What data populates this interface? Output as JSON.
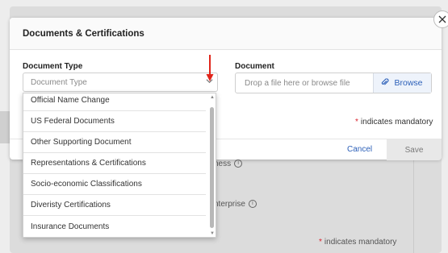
{
  "modal": {
    "title": "Documents & Certifications",
    "close_label": "×"
  },
  "document_type": {
    "label": "Document Type",
    "placeholder": "Document Type"
  },
  "document": {
    "label": "Document",
    "placeholder": "Drop a file here or browse file",
    "browse_label": "Browse"
  },
  "mandatory": {
    "star": "*",
    "text": "indicates mandatory"
  },
  "footer": {
    "cancel_label": "Cancel",
    "save_label": "Save"
  },
  "dropdown": {
    "options": [
      "Official Name Change",
      "US Federal Documents",
      "Other Supporting Document",
      "Representations & Certifications",
      "Socio-economic Classifications",
      "Diveristy Certifications",
      "Insurance Documents"
    ]
  },
  "background": {
    "text_1": "ness",
    "text_2": "nterprise",
    "mandatory_text": "indicates mandatory"
  },
  "colors": {
    "accent": "#2b5fb8",
    "required": "#d9232e",
    "annotation_arrow": "#e0251b"
  },
  "icons": {
    "close": "close-icon",
    "chevron": "chevron-down-icon",
    "clip": "paperclip-icon",
    "info": "info-icon"
  }
}
